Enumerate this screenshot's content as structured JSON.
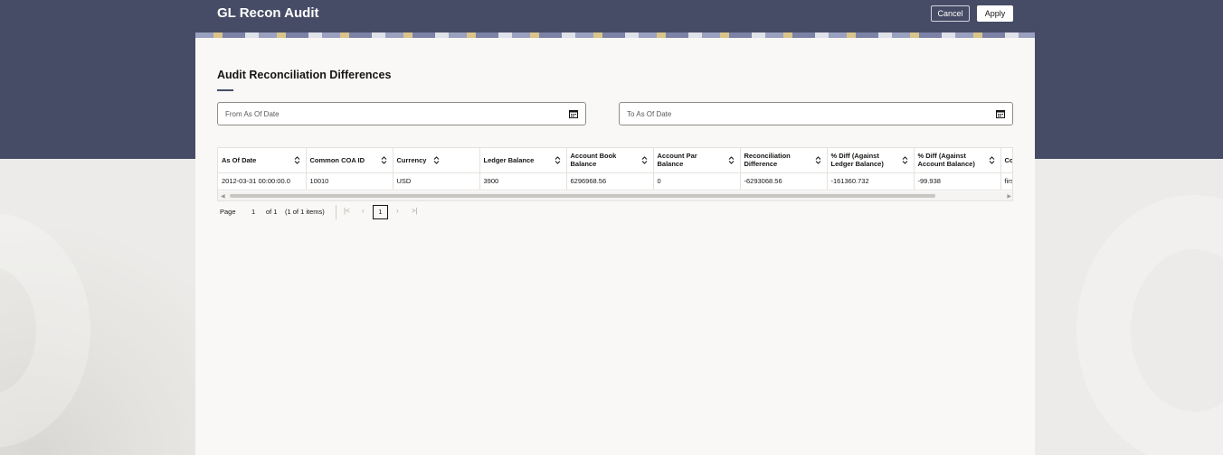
{
  "header": {
    "title": "GL Recon Audit",
    "cancel_label": "Cancel",
    "apply_label": "Apply"
  },
  "section": {
    "title": "Audit Reconciliation Differences"
  },
  "filters": {
    "from_label": "From As Of Date",
    "to_label": "To As Of Date"
  },
  "table": {
    "columns": [
      "As Of Date",
      "Common COA ID",
      "Currency",
      "Ledger Balance",
      "Account Book Balance",
      "Account Par Balance",
      "Reconciliation Difference",
      "% Diff (Against Ledger Balance)",
      "% Diff (Against Account Balance)",
      "Co"
    ],
    "rows": [
      [
        "2012-03-31 00:00:00.0",
        "10010",
        "USD",
        "3900",
        "6296968.56",
        "0",
        "-6293068.56",
        "-161360.732",
        "-99.938",
        "firs"
      ]
    ]
  },
  "pagination": {
    "page_label": "Page",
    "page_value": "1",
    "of_label": "of 1",
    "items_label": "(1 of 1 items)",
    "current_page": "1"
  },
  "colors": {
    "header_band": "#474c66",
    "panel": "#f9f8f6"
  }
}
